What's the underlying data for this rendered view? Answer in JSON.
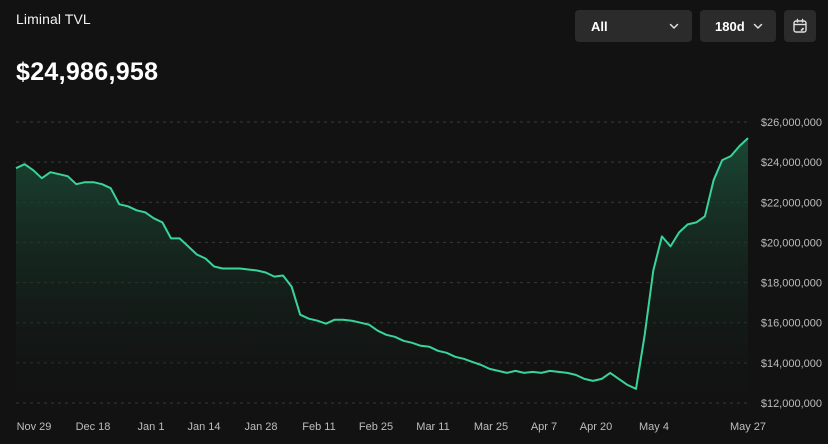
{
  "header": {
    "title": "Liminal TVL",
    "value": "$24,986,958"
  },
  "controls": {
    "filter_label": "All",
    "range_label": "180d",
    "calendar_icon": "calendar-icon"
  },
  "colors": {
    "line": "#3ad49a",
    "fill_top": "#1b4a36",
    "background": "#121212"
  },
  "chart_data": {
    "type": "area",
    "title": "",
    "xlabel": "",
    "ylabel": "",
    "ylim": [
      12000000,
      26000000
    ],
    "y_ticks": [
      "$26,000,000",
      "$24,000,000",
      "$22,000,000",
      "$20,000,000",
      "$18,000,000",
      "$16,000,000",
      "$14,000,000",
      "$12,000,000"
    ],
    "x_ticks": [
      "Nov 29",
      "Dec 18",
      "Jan 1",
      "Jan 14",
      "Jan 28",
      "Feb 11",
      "Feb 25",
      "Mar 11",
      "Mar 25",
      "Apr 7",
      "Apr 20",
      "May 4",
      "May 27"
    ],
    "grid": true,
    "x_start": "Nov 29",
    "x_end": "May 27",
    "series": [
      {
        "values": [
          23700000,
          23900000,
          23600000,
          23200000,
          23500000,
          23400000,
          23300000,
          22900000,
          23000000,
          23000000,
          22900000,
          22700000,
          21900000,
          21800000,
          21600000,
          21500000,
          21200000,
          21000000,
          20200000,
          20200000,
          19800000,
          19400000,
          19200000,
          18800000,
          18700000,
          18700000,
          18700000,
          18650000,
          18600000,
          18500000,
          18300000,
          18350000,
          17800000,
          16400000,
          16200000,
          16100000,
          15950000,
          16150000,
          16150000,
          16100000,
          16000000,
          15900000,
          15600000,
          15400000,
          15300000,
          15100000,
          15000000,
          14850000,
          14800000,
          14600000,
          14500000,
          14300000,
          14200000,
          14050000,
          13900000,
          13700000,
          13600000,
          13500000,
          13600000,
          13500000,
          13550000,
          13500000,
          13600000,
          13550000,
          13500000,
          13400000,
          13200000,
          13100000,
          13200000,
          13500000,
          13200000,
          12900000,
          12700000,
          15400000,
          18600000,
          20300000,
          19800000,
          20500000,
          20900000,
          21000000,
          21300000,
          23100000,
          24100000,
          24300000,
          24800000,
          25200000
        ]
      }
    ]
  }
}
